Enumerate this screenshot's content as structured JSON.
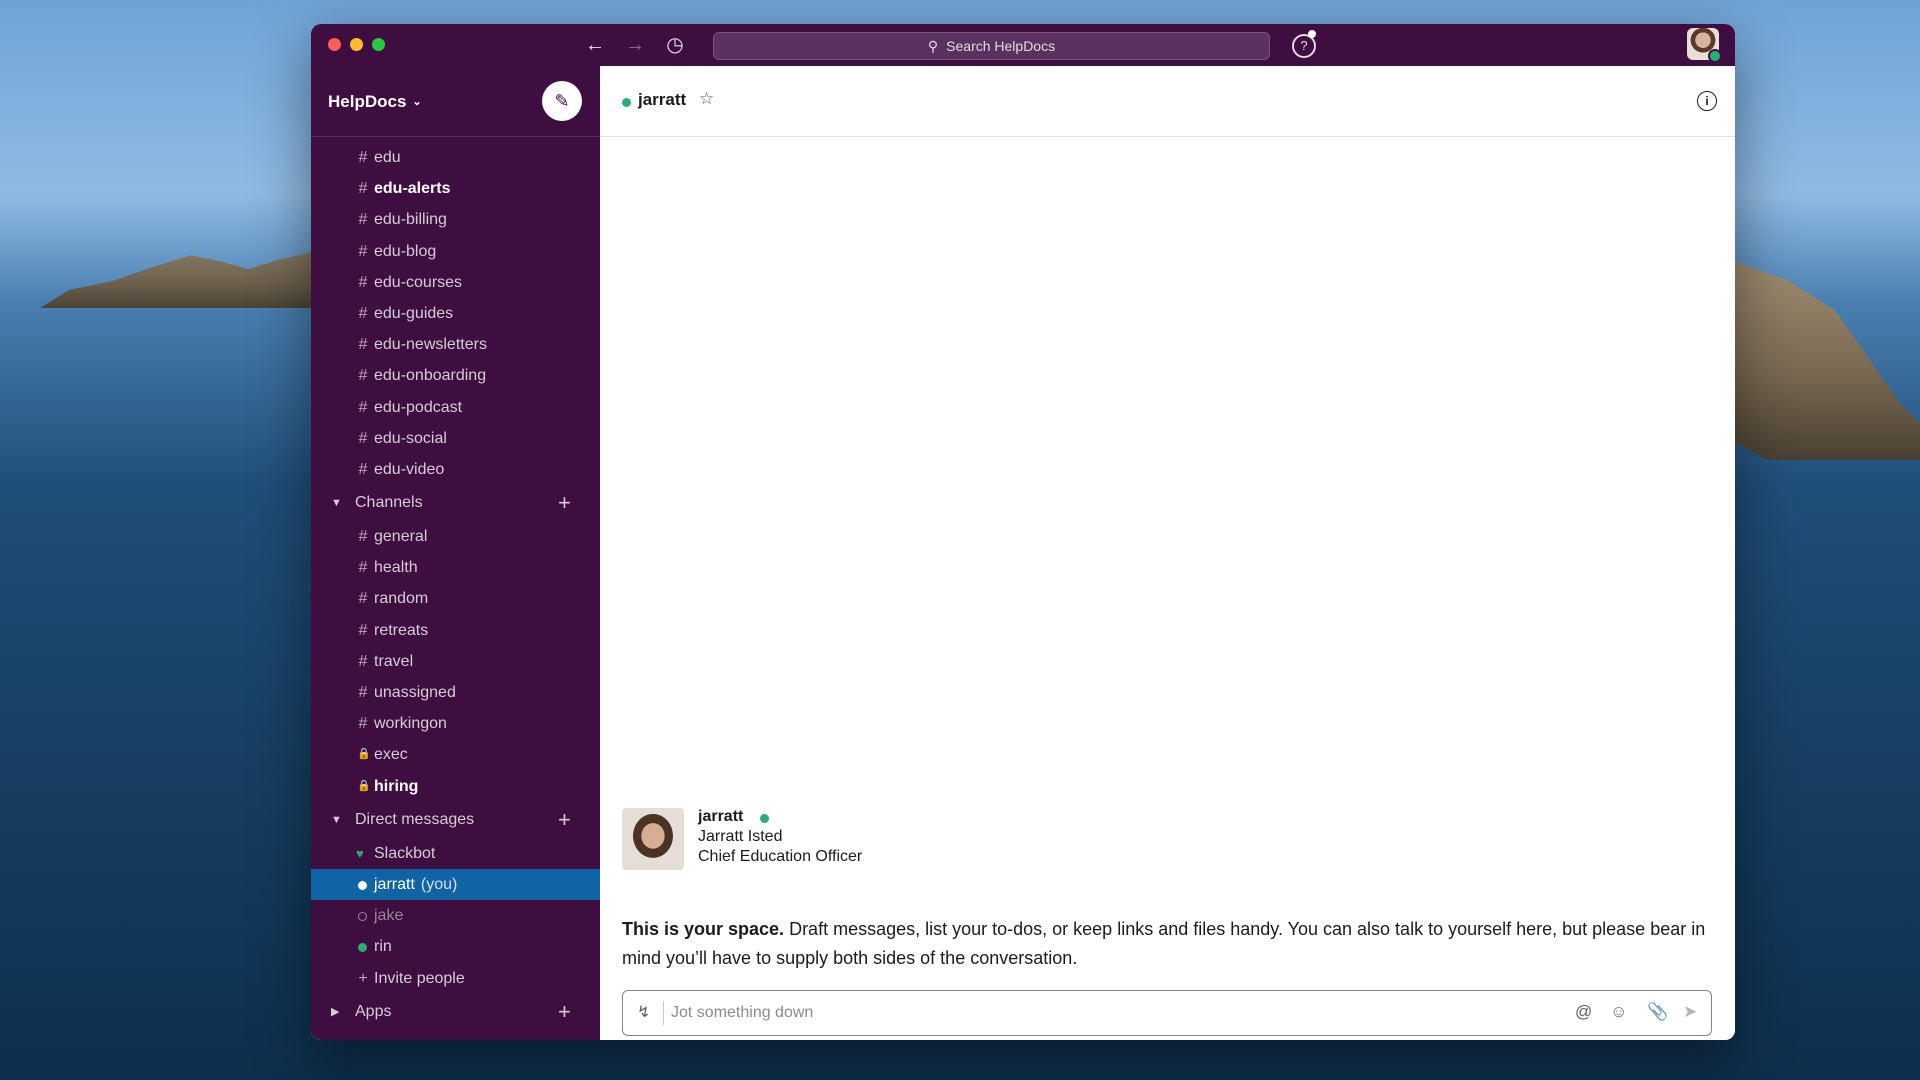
{
  "desktop": {
    "colors": {
      "sky": "#8fbbe3",
      "sea": "#1f4e78"
    }
  },
  "titlebar": {
    "search_placeholder": "Search HelpDocs",
    "icons": [
      "back-arrow-icon",
      "forward-arrow-icon",
      "history-icon",
      "search-icon",
      "help-icon"
    ]
  },
  "sidebar": {
    "workspace_name": "HelpDocs",
    "edu_channels": [
      {
        "label": "edu",
        "bold": false
      },
      {
        "label": "edu-alerts",
        "bold": true
      },
      {
        "label": "edu-billing",
        "bold": false
      },
      {
        "label": "edu-blog",
        "bold": false
      },
      {
        "label": "edu-courses",
        "bold": false
      },
      {
        "label": "edu-guides",
        "bold": false
      },
      {
        "label": "edu-newsletters",
        "bold": false
      },
      {
        "label": "edu-onboarding",
        "bold": false
      },
      {
        "label": "edu-podcast",
        "bold": false
      },
      {
        "label": "edu-social",
        "bold": false
      },
      {
        "label": "edu-video",
        "bold": false
      }
    ],
    "channels_section": "Channels",
    "channels": [
      {
        "label": "general",
        "prefix": "#",
        "bold": false
      },
      {
        "label": "health",
        "prefix": "#",
        "bold": false
      },
      {
        "label": "random",
        "prefix": "#",
        "bold": false
      },
      {
        "label": "retreats",
        "prefix": "#",
        "bold": false
      },
      {
        "label": "travel",
        "prefix": "#",
        "bold": false
      },
      {
        "label": "unassigned",
        "prefix": "#",
        "bold": false
      },
      {
        "label": "workingon",
        "prefix": "#",
        "bold": false
      },
      {
        "label": "exec",
        "prefix": "lock",
        "bold": false
      },
      {
        "label": "hiring",
        "prefix": "lock",
        "bold": true
      }
    ],
    "dm_section": "Direct messages",
    "dms": [
      {
        "label": "Slackbot",
        "status": "heart"
      },
      {
        "label": "jarratt",
        "suffix": "(you)",
        "status": "active"
      },
      {
        "label": "jake",
        "status": "away"
      },
      {
        "label": "rin",
        "status": "online"
      }
    ],
    "invite_label": "Invite people",
    "apps_section": "Apps",
    "colors": {
      "background": "#3f0e40",
      "active_row": "#1164a3",
      "presence": "#2bac76"
    }
  },
  "main": {
    "header": {
      "channel_name": "jarratt"
    },
    "profile": {
      "username": "jarratt",
      "full_name": "Jarratt Isted",
      "title": "Chief Education Officer"
    },
    "intro_bold": "This is your space.",
    "intro_text": " Draft messages, list your to-dos, or keep links and files handy. You can also talk to yourself here, but please bear in mind you’ll have to supply both sides of the conversation.",
    "composer": {
      "placeholder": "Jot something down",
      "icons": [
        "shortcuts-bolt-icon",
        "mention-icon",
        "emoji-icon",
        "attachment-icon",
        "send-icon"
      ]
    }
  }
}
